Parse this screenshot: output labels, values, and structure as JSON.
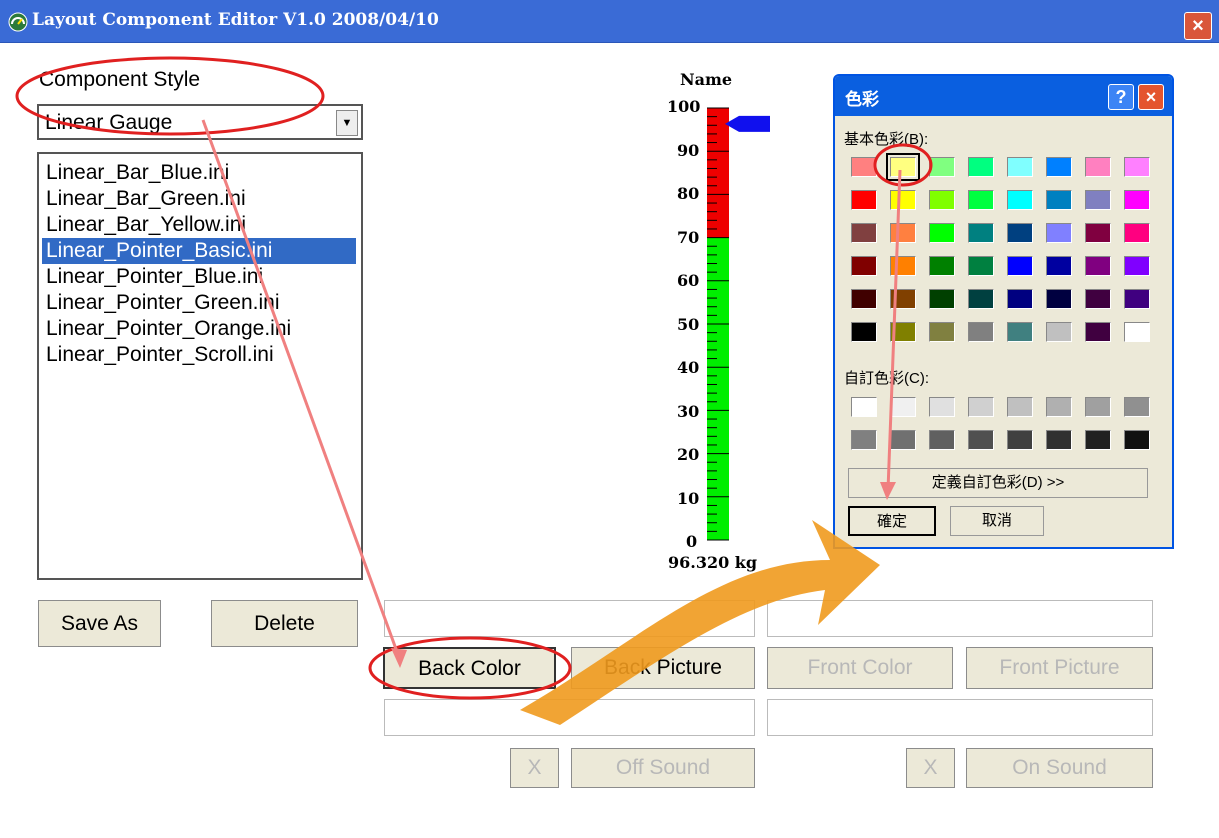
{
  "window": {
    "title": "Layout Component Editor V1.0  2008/04/10",
    "close": "×"
  },
  "component_style": {
    "label": "Component Style",
    "selected": "Linear Gauge"
  },
  "files": [
    "Linear_Bar_Blue.ini",
    "Linear_Bar_Green.ini",
    "Linear_Bar_Yellow.ini",
    "Linear_Pointer_Basic.ini",
    "Linear_Pointer_Blue.ini",
    "Linear_Pointer_Green.ini",
    "Linear_Pointer_Orange.ini",
    "Linear_Pointer_Scroll.ini"
  ],
  "selected_file_index": 3,
  "buttons": {
    "save_as": "Save As",
    "delete": "Delete",
    "back_color": "Back Color",
    "back_picture": "Back Picture",
    "front_color": "Front Color",
    "front_picture": "Front Picture",
    "x1": "X",
    "off_sound": "Off Sound",
    "x2": "X",
    "on_sound": "On Sound"
  },
  "gauge": {
    "name": "Name",
    "ticks": [
      "100",
      "90",
      "80",
      "70",
      "60",
      "50",
      "40",
      "30",
      "20",
      "10",
      "0"
    ],
    "value_text": "96.320 kg",
    "value": 96.32,
    "red_threshold": 70,
    "colors": {
      "high": "#ee0000",
      "low": "#00ee00",
      "pointer": "#1010ee"
    }
  },
  "color_dialog": {
    "title": "色彩",
    "help": "?",
    "close": "×",
    "basic_label": "基本色彩(B):",
    "custom_label": "自訂色彩(C):",
    "define_button": "定義自訂色彩(D) >>",
    "ok_button": "確定",
    "cancel_button": "取消",
    "basic_colors": [
      [
        "#ff8080",
        "#ffff80",
        "#80ff80",
        "#00ff80",
        "#80ffff",
        "#0080ff",
        "#ff80c0",
        "#ff80ff"
      ],
      [
        "#ff0000",
        "#ffff00",
        "#80ff00",
        "#00ff40",
        "#00ffff",
        "#0080c0",
        "#8080c0",
        "#ff00ff"
      ],
      [
        "#804040",
        "#ff8040",
        "#00ff00",
        "#008080",
        "#004080",
        "#8080ff",
        "#800040",
        "#ff0080"
      ],
      [
        "#800000",
        "#ff8000",
        "#008000",
        "#008040",
        "#0000ff",
        "#0000a0",
        "#800080",
        "#8000ff"
      ],
      [
        "#400000",
        "#804000",
        "#004000",
        "#004040",
        "#000080",
        "#000040",
        "#400040",
        "#400080"
      ],
      [
        "#000000",
        "#808000",
        "#808040",
        "#808080",
        "#408080",
        "#c0c0c0",
        "#400040",
        "#ffffff"
      ]
    ],
    "custom_colors": [
      [
        "#ffffff",
        "#f0f0f0",
        "#e0e0e0",
        "#d0d0d0",
        "#c0c0c0",
        "#b0b0b0",
        "#a0a0a0",
        "#909090"
      ],
      [
        "#808080",
        "#707070",
        "#606060",
        "#505050",
        "#404040",
        "#303030",
        "#202020",
        "#101010"
      ]
    ]
  }
}
